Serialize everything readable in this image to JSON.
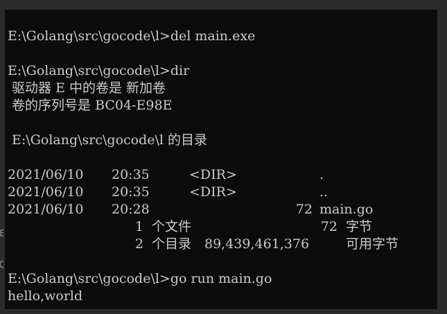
{
  "terminal": {
    "lines": {
      "l0": "E:\\Golang\\src\\gocode\\l>del main.exe",
      "l2": "E:\\Golang\\src\\gocode\\l>dir",
      "l3": " 驱动器 E 中的卷是 新加卷",
      "l4": " 卷的序列号是 BC04-E98E",
      "l6": " E:\\Golang\\src\\gocode\\l 的目录",
      "l14": "E:\\Golang\\src\\gocode\\l>go run main.go",
      "l15": "hello,world"
    },
    "dir_rows": [
      {
        "date": "2021/06/10",
        "time": "20:35",
        "type": "<DIR>",
        "size": "",
        "name": "."
      },
      {
        "date": "2021/06/10",
        "time": "20:35",
        "type": "<DIR>",
        "size": "",
        "name": ".."
      },
      {
        "date": "2021/06/10",
        "time": "20:28",
        "type": "",
        "size": "72",
        "name": "main.go"
      }
    ],
    "summary": {
      "files_count": "1",
      "files_label": "个文件",
      "files_size": "72",
      "files_unit": "字节",
      "dirs_count": "2",
      "dirs_label": "个目录",
      "free_bytes": "89,439,461,376",
      "free_label": "可用字节"
    }
  },
  "background_edge": {
    "g1": "e",
    "g2": "c"
  },
  "colors": {
    "terminal_bg": "#0c0c0c",
    "terminal_text": "#cccccc",
    "window_bg": "#2b2b2b"
  }
}
